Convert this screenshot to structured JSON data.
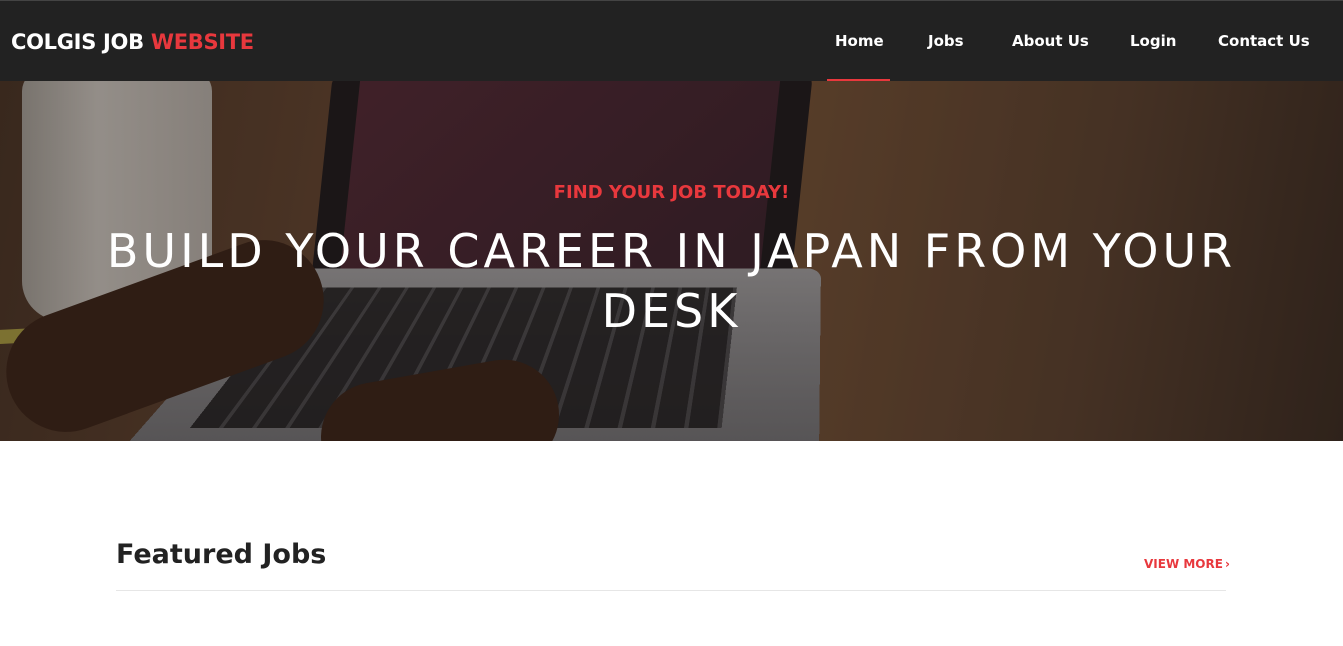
{
  "header": {
    "brand_main": "COLGIS JOB",
    "brand_accent": "WEBSITE",
    "nav": [
      {
        "label": "Home",
        "active": true
      },
      {
        "label": "Jobs"
      },
      {
        "label": "About Us"
      },
      {
        "label": "Login"
      },
      {
        "label": "Contact Us"
      }
    ]
  },
  "hero": {
    "tagline": "FIND YOUR JOB TODAY!",
    "title": "BUILD YOUR CAREER IN JAPAN FROM YOUR DESK"
  },
  "featured": {
    "title": "Featured Jobs",
    "view_more_label": "VIEW MORE",
    "view_more_icon": "chevron-right-icon"
  },
  "colors": {
    "accent": "#e8383d",
    "navbar_bg": "#222222"
  }
}
